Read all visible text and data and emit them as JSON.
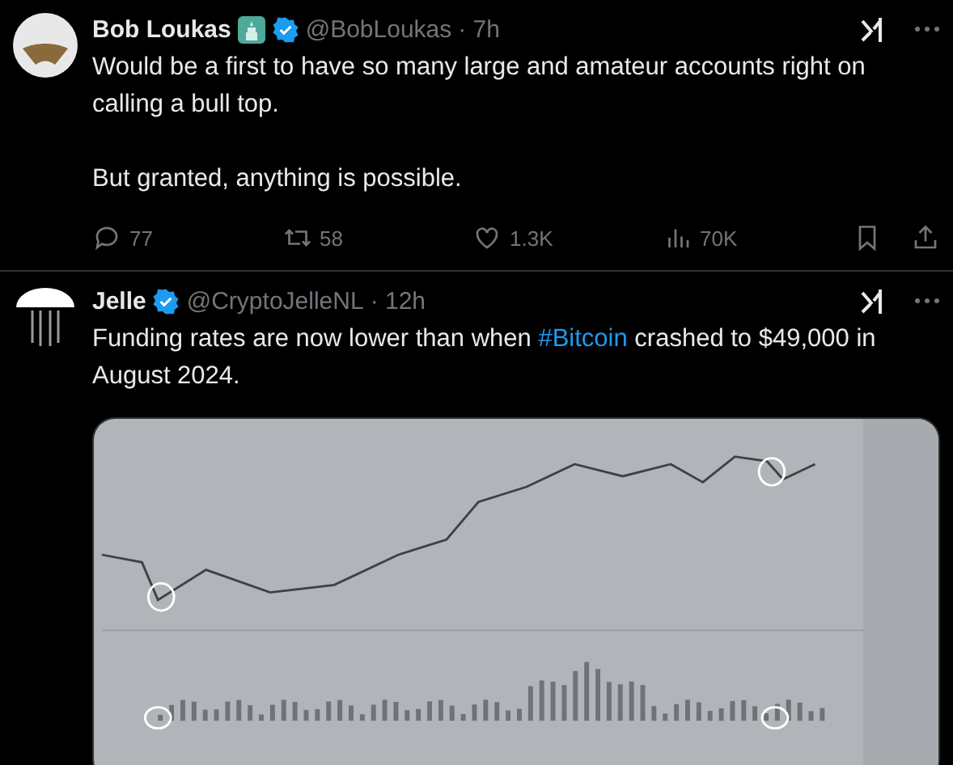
{
  "posts": [
    {
      "name": "Bob Loukas",
      "badge_emoji": true,
      "verified": true,
      "handle": "@BobLoukas",
      "time": "· 7h",
      "paragraphs": [
        [
          {
            "text": "Would be a first to have so many large and amateur accounts right on calling a bull top."
          }
        ],
        [
          {
            "text": "But granted, anything is possible."
          }
        ]
      ],
      "actions": [
        {
          "kind": "reply",
          "count": "77"
        },
        {
          "kind": "repost",
          "count": "58"
        },
        {
          "kind": "like",
          "count": "1.3K"
        },
        {
          "kind": "views",
          "count": "70K"
        }
      ]
    },
    {
      "name": "Jelle",
      "badge_emoji": false,
      "verified": true,
      "handle": "@CryptoJelleNL",
      "time": "· 12h",
      "paragraphs": [
        [
          {
            "text": "Funding rates are now lower than when "
          },
          {
            "text": "#Bitcoin",
            "kind": "hashtag"
          },
          {
            "text": " crashed to $49,000 in August 2024."
          }
        ]
      ],
      "media": {
        "kind": "picture"
      }
    }
  ]
}
